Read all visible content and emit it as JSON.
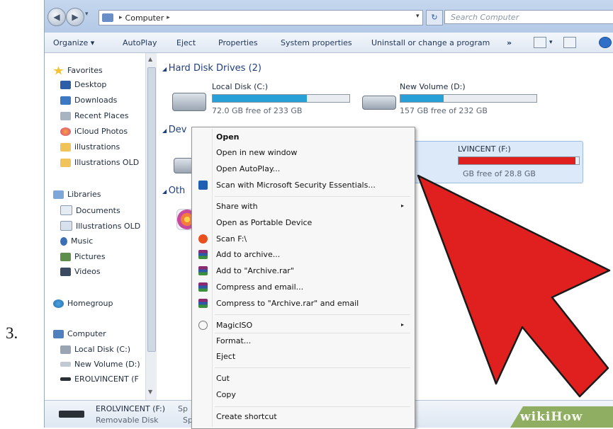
{
  "step_number": "3.",
  "address": {
    "crumb": "Computer",
    "search_placeholder": "Search Computer"
  },
  "toolbar": {
    "organize": "Organize ▾",
    "autoplay": "AutoPlay",
    "eject": "Eject",
    "properties": "Properties",
    "system_properties": "System properties",
    "uninstall": "Uninstall or change a program",
    "more": "»"
  },
  "nav": {
    "favorites": "Favorites",
    "desktop": "Desktop",
    "downloads": "Downloads",
    "recent": "Recent Places",
    "icloud": "iCloud Photos",
    "illustrations": "illustrations",
    "illustrations_old": "Illustrations OLD",
    "libraries": "Libraries",
    "documents": "Documents",
    "lib_illustrations_old": "Illustrations OLD",
    "music": "Music",
    "pictures": "Pictures",
    "videos": "Videos",
    "homegroup": "Homegroup",
    "computer": "Computer",
    "local_disk": "Local Disk (C:)",
    "new_volume": "New Volume (D:)",
    "erol": "EROLVINCENT (F"
  },
  "content": {
    "hdd_group": "Hard Disk Drives (2)",
    "dev_group": "Dev",
    "other_group": "Oth",
    "drive_c": {
      "name": "Local Disk (C:)",
      "free": "72.0 GB free of 233 GB",
      "used_fraction": 0.69
    },
    "drive_d": {
      "name": "New Volume (D:)",
      "free": "157 GB free of 232 GB",
      "used_fraction": 0.32
    },
    "drive_f": {
      "name": "LVINCENT (F:)",
      "free": "GB free of 28.8 GB",
      "used_fraction": 0.97
    }
  },
  "context_menu": {
    "open": "Open",
    "open_new_window": "Open in new window",
    "open_autoplay": "Open AutoPlay...",
    "scan_mse": "Scan with Microsoft Security Essentials...",
    "share_with": "Share with",
    "open_portable": "Open as Portable Device",
    "scan_f": "Scan F:\\",
    "add_archive": "Add to archive...",
    "add_archive_rar": "Add to \"Archive.rar\"",
    "compress_email": "Compress and email...",
    "compress_rar_email": "Compress to \"Archive.rar\" and email",
    "magiciso": "MagicISO",
    "format": "Format...",
    "eject": "Eject",
    "cut": "Cut",
    "copy": "Copy",
    "create_shortcut": "Create shortcut",
    "submenu_arrow": "▸"
  },
  "status": {
    "name": "EROLVINCENT (F:)",
    "name_tail": "Sp",
    "type": "Removable Disk",
    "type_tail": "Sp"
  },
  "watermark": {
    "wiki": "wiki",
    "how": "How"
  },
  "colors": {
    "bar_blue": "#27a0d8",
    "bar_red": "#e0201e",
    "arrow_red": "#e0201e",
    "wikihow_green": "#8fae62"
  }
}
